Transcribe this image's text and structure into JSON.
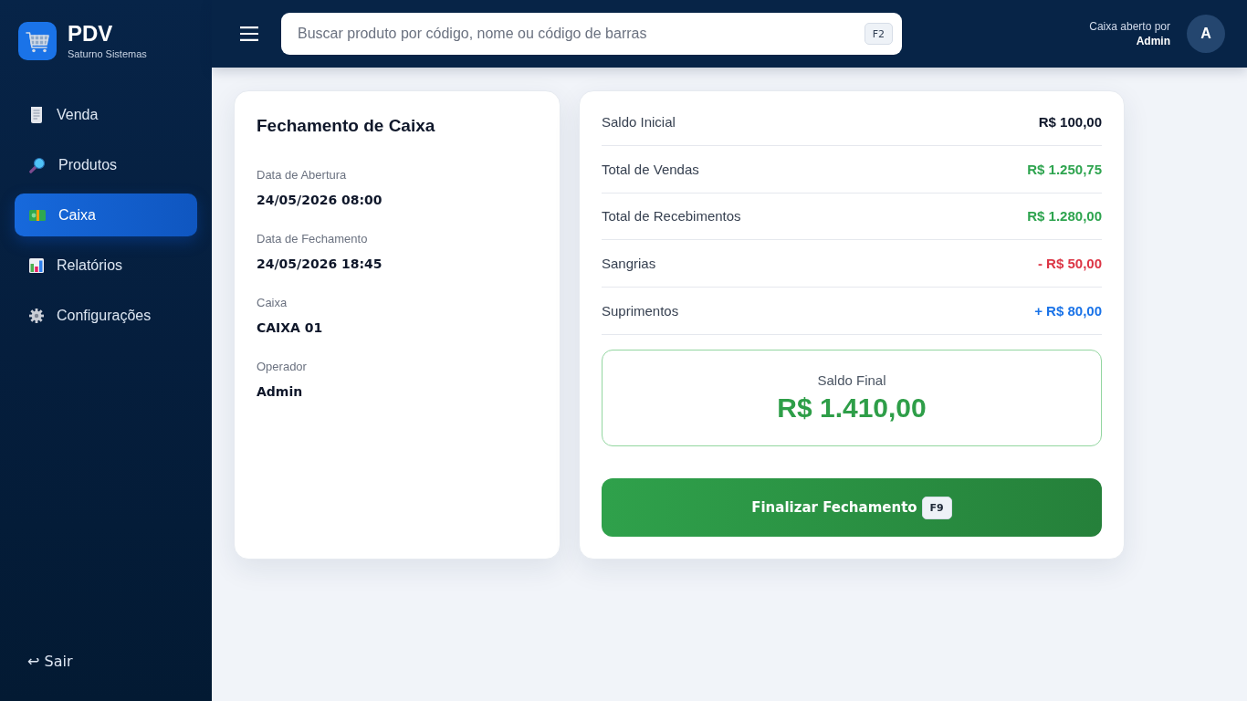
{
  "brand": {
    "title": "PDV",
    "subtitle": "Saturno Sistemas"
  },
  "sidebar": {
    "items": [
      {
        "label": "Venda",
        "selected": false
      },
      {
        "label": "Produtos",
        "selected": false
      },
      {
        "label": "Caixa",
        "selected": true
      },
      {
        "label": "Relatórios",
        "selected": false
      },
      {
        "label": "Configurações",
        "selected": false
      }
    ],
    "logout": {
      "icon": "↩",
      "label": "Sair"
    }
  },
  "header": {
    "search": {
      "placeholder": "Buscar produto por código, nome ou código de barras",
      "shortcut": "F2"
    },
    "user": {
      "caption": "Caixa aberto por",
      "name": "Admin",
      "avatar": "A"
    }
  },
  "closing_info": {
    "title": "Fechamento de Caixa",
    "fields": [
      {
        "label": "Data de Abertura",
        "value": "24/05/2026 08:00"
      },
      {
        "label": "Data de Fechamento",
        "value": "24/05/2026 18:45"
      },
      {
        "label": "Caixa",
        "value": "CAIXA 01"
      },
      {
        "label": "Operador",
        "value": "Admin"
      }
    ]
  },
  "summary": {
    "rows": [
      {
        "label": "Saldo Inicial",
        "value": "R$ 100,00",
        "color": "#0f172a"
      },
      {
        "label": "Total de Vendas",
        "value": "R$ 1.250,75",
        "color": "#2ea44f"
      },
      {
        "label": "Total de Recebimentos",
        "value": "R$ 1.280,00",
        "color": "#2ea44f"
      },
      {
        "label": "Sangrias",
        "value": "- R$ 50,00",
        "color": "#dc3545"
      },
      {
        "label": "Suprimentos",
        "value": "+ R$ 80,00",
        "color": "#1a73e8"
      }
    ],
    "final_balance": {
      "label": "Saldo Final",
      "value": "R$ 1.410,00"
    },
    "action": {
      "label": "Finalizar Fechamento",
      "shortcut": "F9"
    }
  }
}
